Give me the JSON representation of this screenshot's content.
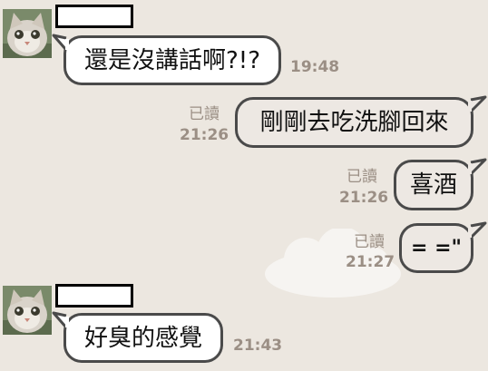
{
  "chat": {
    "messages": [
      {
        "sender": "other",
        "text": "還是沒講話啊?!?",
        "time": "19:48"
      },
      {
        "sender": "self",
        "text": "剛剛去吃洗腳回來",
        "read": "已讀",
        "time": "21:26"
      },
      {
        "sender": "self",
        "text": "喜酒",
        "read": "已讀",
        "time": "21:26"
      },
      {
        "sender": "self",
        "text": "= =\"",
        "read": "已讀",
        "time": "21:27"
      },
      {
        "sender": "other",
        "text": "好臭的感覺",
        "time": "21:43"
      }
    ]
  }
}
